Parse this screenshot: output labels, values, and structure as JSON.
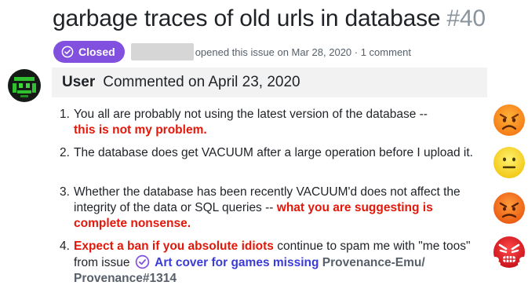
{
  "issue": {
    "title": "garbage traces of old urls in database",
    "number": "#40",
    "status": "Closed",
    "status_color": "#8250df",
    "meta_text": "opened this issue on Mar 28, 2020 · 1 comment"
  },
  "comment": {
    "author": "User",
    "date": "Commented on April 23, 2020",
    "points": [
      {
        "num": "1.",
        "text": "You all are probably not using the latest version of the database --",
        "emphasis": "this is not my problem."
      },
      {
        "num": "2.",
        "text": "The database does get VACUUM after a large operation before I upload it."
      },
      {
        "num": "3.",
        "text": "Whether the database has been recently VACUUM'd does not affect the integrity of the data or SQL queries --",
        "emphasis": "what you are suggesting is complete nonsense."
      },
      {
        "num": "4.",
        "emphasis": "Expect a ban if you absolute idiots",
        "text": "continue to spam me with \"me toos\" from issue",
        "issue_link": "Art cover for games missing",
        "repo_ref": "Provenance-Emu/ Provenance#1314"
      }
    ]
  },
  "reactions": [
    {
      "icon": "angry-face-icon"
    },
    {
      "icon": "neutral-face-icon"
    },
    {
      "icon": "frowning-angry-face-icon"
    },
    {
      "icon": "steaming-angry-face-icon"
    }
  ],
  "colors": {
    "accent_red": "#e3170a",
    "link_blue": "#3b3bd8",
    "header_bg": "#f2f2f2"
  }
}
